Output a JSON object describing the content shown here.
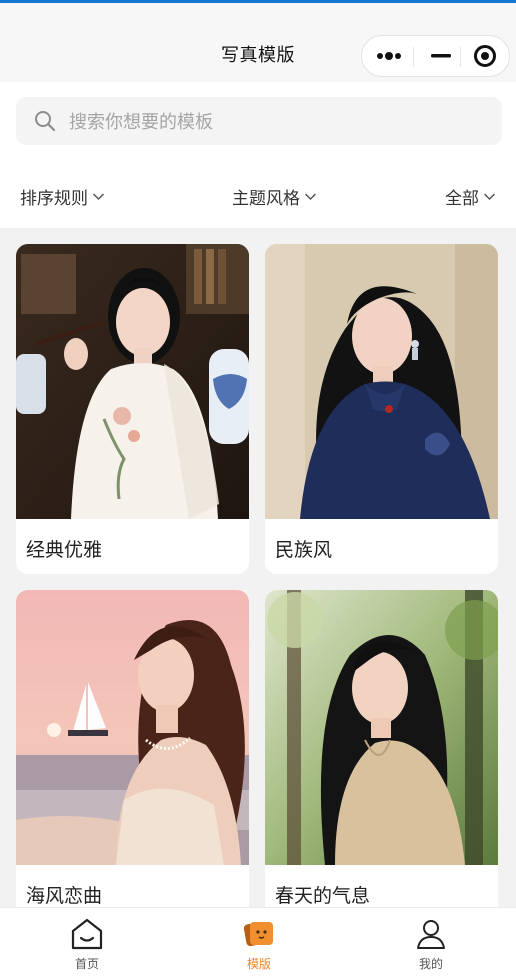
{
  "header": {
    "title": "写真模版"
  },
  "search": {
    "placeholder": "搜索你想要的模板"
  },
  "filters": [
    {
      "label": "排序规则"
    },
    {
      "label": "主题风格"
    },
    {
      "label": "全部"
    }
  ],
  "templates": [
    {
      "name": "经典优雅"
    },
    {
      "name": "民族风"
    },
    {
      "name": "海风恋曲"
    },
    {
      "name": "春天的气息"
    }
  ],
  "tabbar": {
    "items": [
      {
        "label": "首页",
        "icon": "home-icon",
        "active": false
      },
      {
        "label": "模版",
        "icon": "template-icon",
        "active": true
      },
      {
        "label": "我的",
        "icon": "user-icon",
        "active": false
      }
    ],
    "active_color": "#e8892d"
  },
  "colors": {
    "accent": "#e8892d",
    "top_stripe": "#1677d2"
  }
}
